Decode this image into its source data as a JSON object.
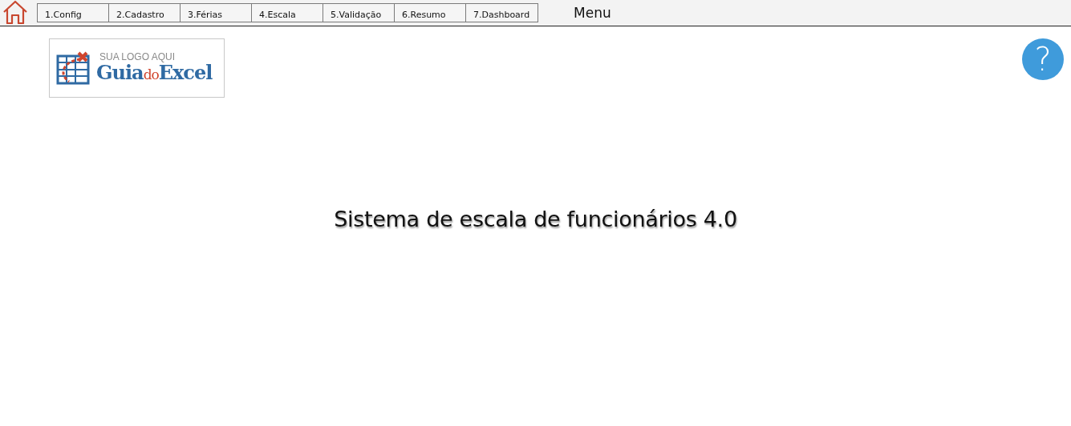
{
  "menu_bar": {
    "tabs": [
      {
        "label": "1.Config"
      },
      {
        "label": "2.Cadastro"
      },
      {
        "label": "3.Férias"
      },
      {
        "label": "4.Escala"
      },
      {
        "label": "5.Validação"
      },
      {
        "label": "6.Resumo"
      },
      {
        "label": "7.Dashboard"
      }
    ],
    "title": "Menu"
  },
  "logo": {
    "tagline": "SUA LOGO AQUI",
    "wordmark": [
      "Guia",
      "do",
      "Excel"
    ]
  },
  "help_button": {
    "label": "?"
  },
  "heading": "Sistema de escala de funcionários 4.0"
}
